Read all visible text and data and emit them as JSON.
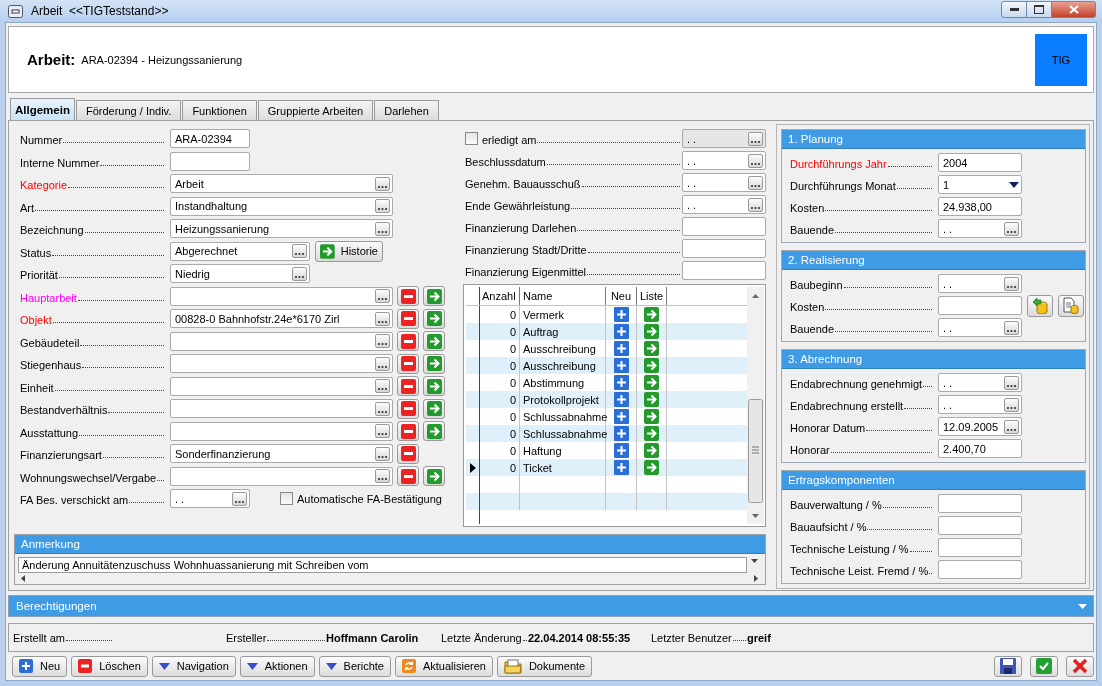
{
  "window": {
    "title": "Arbeit  <<TIGTeststand>>"
  },
  "header": {
    "label": "Arbeit:",
    "value": "ARA-02394 - Heizungssanierung",
    "logo": "TIG"
  },
  "tabs": [
    {
      "label": "Allgemein",
      "selected": true
    },
    {
      "label": "Förderung / Indiv.",
      "selected": false
    },
    {
      "label": "Funktionen",
      "selected": false
    },
    {
      "label": "Gruppierte Arbeiten",
      "selected": false
    },
    {
      "label": "Darlehen",
      "selected": false
    }
  ],
  "fields": [
    {
      "label": "Nummer",
      "value": "ARA-02394",
      "kind": "code"
    },
    {
      "label": "Interne Nummer",
      "kind": "code"
    },
    {
      "label": "Kategorie",
      "value": "Arbeit",
      "kind": "lookup",
      "color": "#ff0000"
    },
    {
      "label": "Art",
      "value": "Instandhaltung",
      "kind": "lookup"
    },
    {
      "label": "Bezeichnung",
      "value": "Heizungssanierung",
      "kind": "lookup"
    },
    {
      "label": "Status",
      "value": "Abgerechnet",
      "kind": "choice",
      "button": "Historie"
    },
    {
      "label": "Priorität",
      "value": "Niedrig",
      "kind": "choice"
    },
    {
      "label": "Hauptarbeit",
      "kind": "lookup",
      "color": "#ff00ff",
      "removable": true,
      "linkable": true
    },
    {
      "label": "Objekt",
      "value": "00828-0 Bahnhofstr.24e*6170 Zirl",
      "kind": "lookup",
      "color": "#ff0000",
      "removable": true,
      "linkable": true
    },
    {
      "label": "Gebäudeteil",
      "kind": "lookup",
      "removable": true,
      "linkable": true
    },
    {
      "label": "Stiegenhaus",
      "kind": "lookup",
      "removable": true,
      "linkable": true
    },
    {
      "label": "Einheit",
      "kind": "lookup",
      "removable": true,
      "linkable": true
    },
    {
      "label": "Bestandverhältnis",
      "kind": "lookup",
      "removable": true,
      "linkable": true
    },
    {
      "label": "Ausstattung",
      "kind": "lookup",
      "removable": true,
      "linkable": true
    },
    {
      "label": "Finanzierungsart",
      "value": "Sonderfinanzierung",
      "kind": "lookup",
      "removable": true,
      "linkable": false
    },
    {
      "label": "Wohnungswechsel/Vergabe",
      "kind": "lookup",
      "removable": true,
      "linkable": true
    },
    {
      "label": "FA Bes. verschickt am",
      "value": ". .",
      "kind": "date",
      "checkbox": {
        "label": "Automatische FA-Bestätigung",
        "checked": false
      }
    }
  ],
  "dates": [
    {
      "label": "erledigt am",
      "value": ". .",
      "kind": "date",
      "checked": false,
      "disabled": true
    },
    {
      "label": "Beschlussdatum",
      "value": ". .",
      "kind": "date"
    },
    {
      "label": "Genehm. Bauausschuß",
      "value": ". .",
      "kind": "date"
    },
    {
      "label": "Ende Gewährleistung",
      "value": ". .",
      "kind": "date"
    },
    {
      "label": "Finanzierung Darlehen",
      "kind": "text"
    },
    {
      "label": "Finanzierung Stadt/Dritte",
      "kind": "text"
    },
    {
      "label": "Finanzierung Eigenmittel",
      "kind": "text"
    }
  ],
  "grid": {
    "columns": [
      "Anzahl",
      "Name",
      "Neu",
      "Liste"
    ],
    "rows": [
      {
        "count": "0",
        "name": "Vermerk",
        "current": false
      },
      {
        "count": "0",
        "name": "Auftrag",
        "current": false
      },
      {
        "count": "0",
        "name": "Ausschreibung",
        "current": false
      },
      {
        "count": "0",
        "name": "Ausschreibung",
        "current": false
      },
      {
        "count": "0",
        "name": "Abstimmung",
        "current": false
      },
      {
        "count": "0",
        "name": "Protokollprojekt",
        "current": false
      },
      {
        "count": "0",
        "name": "Schlussabnahme",
        "current": false
      },
      {
        "count": "0",
        "name": "Schlussabnahme",
        "current": false
      },
      {
        "count": "0",
        "name": "Haftung",
        "current": false
      },
      {
        "count": "0",
        "name": "Ticket",
        "current": true
      }
    ]
  },
  "notes": {
    "title": "Anmerkung",
    "text": "Änderung Annuitätenzuschuss Wohnhuassanierung mit Schreiben vom"
  },
  "sections": [
    {
      "title": "1. Planung",
      "fields": [
        {
          "label": "Durchführungs Jahr",
          "value": "2004",
          "kind": "text",
          "color": "#ff0000"
        },
        {
          "label": "Durchführungs Monat",
          "value": "1",
          "kind": "dropdown"
        },
        {
          "label": "Kosten",
          "value": "24.938,00",
          "kind": "text"
        },
        {
          "label": "Bauende",
          "value": ". .",
          "kind": "date"
        }
      ]
    },
    {
      "title": "2. Realisierung",
      "fields": [
        {
          "label": "Baubeginn",
          "value": ". .",
          "kind": "date"
        },
        {
          "label": "Kosten",
          "kind": "calc"
        },
        {
          "label": "Bauende",
          "value": ". .",
          "kind": "date"
        }
      ]
    },
    {
      "title": "3. Abrechnung",
      "fields": [
        {
          "label": "Endabrechnung genehmigt",
          "value": ". .",
          "kind": "date"
        },
        {
          "label": "Endabrechnung erstellt",
          "value": ". .",
          "kind": "date"
        },
        {
          "label": "Honorar Datum",
          "value": "12.09.2005",
          "kind": "date"
        },
        {
          "label": "Honorar",
          "value": "2.400,70",
          "kind": "text"
        }
      ]
    },
    {
      "title": "Ertragskomponenten",
      "fields": [
        {
          "label": "Bauverwaltung / %",
          "kind": "text"
        },
        {
          "label": "Bauaufsicht / %",
          "kind": "text"
        },
        {
          "label": "Technische Leistung / %",
          "kind": "text"
        },
        {
          "label": "Technische Leist. Fremd / %",
          "kind": "text"
        }
      ]
    }
  ],
  "permissions": {
    "title": "Berechtigungen"
  },
  "status_bar": [
    {
      "label": "Erstellt am"
    },
    {
      "label": "Ersteller",
      "value": "Hoffmann Carolin"
    },
    {
      "label": "Letzte Änderung",
      "value": "22.04.2014 08:55:35"
    },
    {
      "label": "Letzter Benutzer",
      "value": "greif"
    }
  ],
  "toolbar": {
    "left": [
      {
        "label": "Neu",
        "kind": "add"
      },
      {
        "label": "Löschen",
        "kind": "delete"
      },
      {
        "label": "Navigation",
        "kind": "menu"
      },
      {
        "label": "Aktionen",
        "kind": "menu"
      },
      {
        "label": "Berichte",
        "kind": "menu"
      },
      {
        "label": "Aktualisieren",
        "kind": "refresh"
      },
      {
        "label": "Dokumente",
        "kind": "documents"
      }
    ],
    "right": [
      {
        "kind": "save"
      },
      {
        "kind": "ok"
      },
      {
        "kind": "cancel"
      }
    ]
  }
}
